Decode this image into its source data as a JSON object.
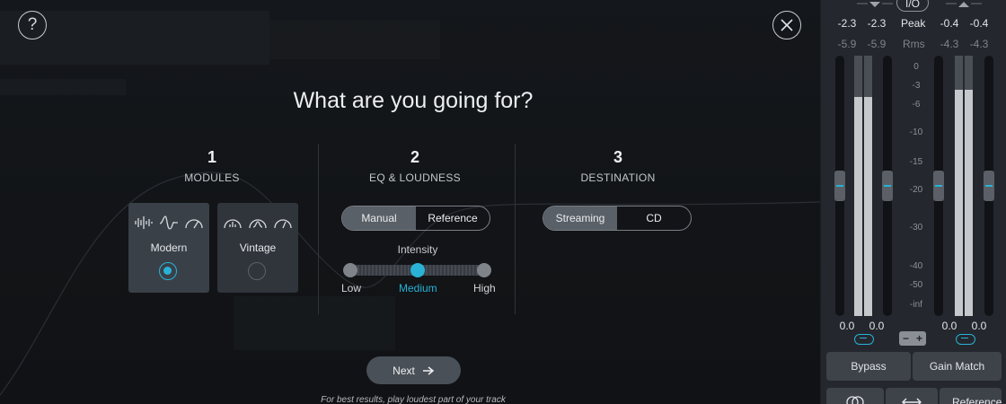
{
  "dialog": {
    "help_label": "?",
    "heading": "What are you going for?",
    "steps": [
      {
        "number": "1",
        "title": "MODULES"
      },
      {
        "number": "2",
        "title": "EQ & LOUDNESS"
      },
      {
        "number": "3",
        "title": "DESTINATION"
      }
    ],
    "modules": [
      {
        "label": "Modern",
        "selected": true
      },
      {
        "label": "Vintage",
        "selected": false
      }
    ],
    "eq_mode": {
      "options": [
        "Manual",
        "Reference"
      ],
      "selected": "Manual"
    },
    "intensity": {
      "label": "Intensity",
      "levels": [
        "Low",
        "Medium",
        "High"
      ],
      "selected": "Medium"
    },
    "destination": {
      "options": [
        "Streaming",
        "CD"
      ],
      "selected": "Streaming"
    },
    "next_label": "Next",
    "hint": "For best results, play loudest part of your track"
  },
  "io_panel": {
    "badge": "I/O",
    "peak_label": "Peak",
    "rms_label": "Rms",
    "input_peak": [
      "-2.3",
      "-2.3"
    ],
    "input_rms": [
      "-5.9",
      "-5.9"
    ],
    "output_peak": [
      "-0.4",
      "-0.4"
    ],
    "output_rms": [
      "-4.3",
      "-4.3"
    ],
    "scale": [
      "0",
      "-3",
      "-6",
      "-10",
      "-15",
      "-20",
      "-30",
      "-40",
      "-50",
      "-inf"
    ],
    "input_gain": [
      "0.0",
      "0.0"
    ],
    "output_gain": [
      "0.0",
      "0.0"
    ],
    "pm_minus": "−",
    "pm_plus": "+",
    "bypass_label": "Bypass",
    "gain_match_label": "Gain Match",
    "reference_label": "Reference"
  },
  "colors": {
    "accent": "#29b2d6",
    "panel": "#24282e",
    "background": "#121417"
  }
}
